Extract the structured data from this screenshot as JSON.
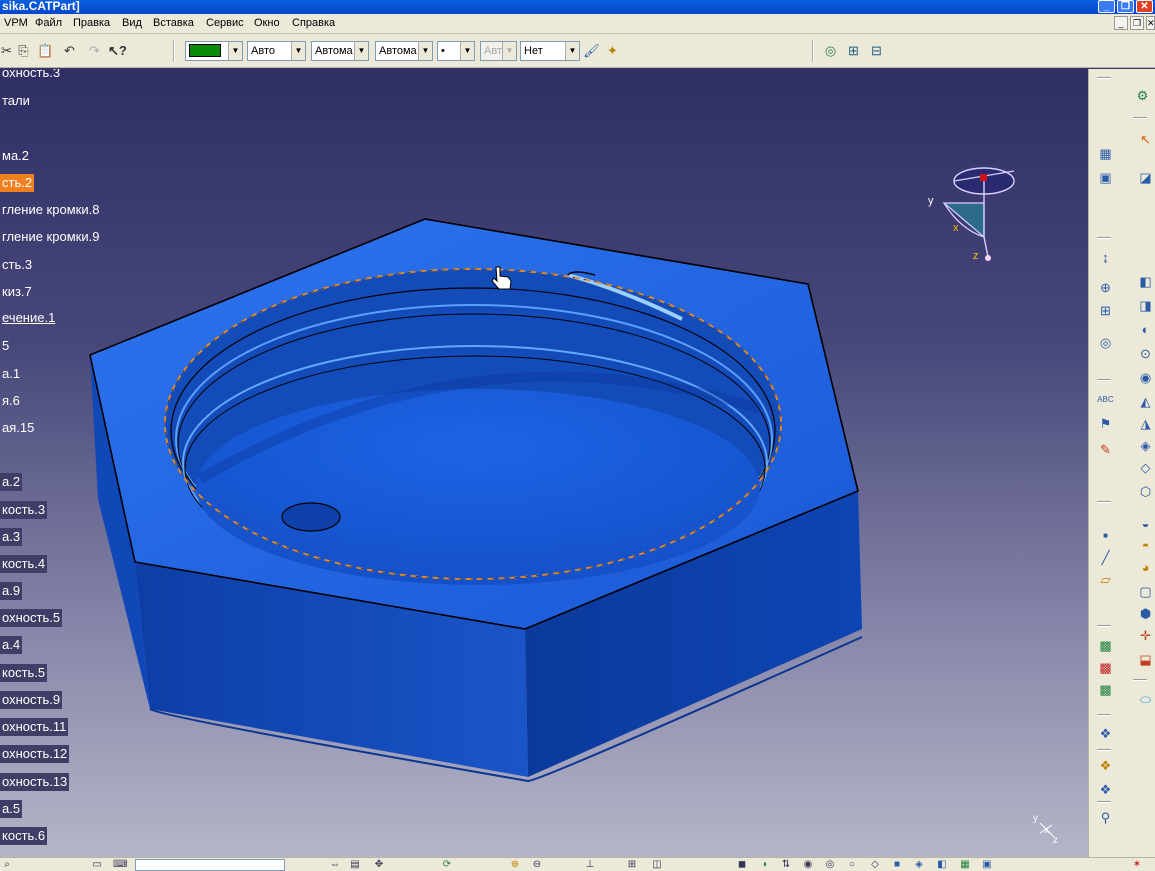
{
  "window": {
    "title": "sika.CATPart]"
  },
  "menu": [
    "VPM",
    "Файл",
    "Правка",
    "Вид",
    "Вставка",
    "Сервис",
    "Окно",
    "Справка"
  ],
  "toolbar": {
    "color_value": "#0a8a0a",
    "combo_transparency": "Авто",
    "combo_linetype": "Автома",
    "combo_thickness": "Автома",
    "combo_point": "•",
    "combo_layer_disabled": "Авт",
    "combo_layer": "Нет"
  },
  "tree": [
    {
      "label": "охность.3",
      "style": "plain"
    },
    {
      "label": "тали",
      "style": "plain"
    },
    {
      "label": "",
      "style": "plain"
    },
    {
      "label": "ма.2",
      "style": "plain"
    },
    {
      "label": "сть.2",
      "style": "sel"
    },
    {
      "label": "гление кромки.8",
      "style": "plain"
    },
    {
      "label": "гление кромки.9",
      "style": "plain"
    },
    {
      "label": "сть.3",
      "style": "plain"
    },
    {
      "label": "киз.7",
      "style": "plain"
    },
    {
      "label": "ечение.1",
      "style": "ul"
    },
    {
      "label": "5",
      "style": "plain"
    },
    {
      "label": "а.1",
      "style": "plain"
    },
    {
      "label": "я.6",
      "style": "plain"
    },
    {
      "label": "ая.15",
      "style": "plain"
    },
    {
      "label": "",
      "style": "plain"
    },
    {
      "label": "а.2",
      "style": "dark"
    },
    {
      "label": "кость.3",
      "style": "dark"
    },
    {
      "label": "а.3",
      "style": "dark"
    },
    {
      "label": "кость.4",
      "style": "dark"
    },
    {
      "label": "а.9",
      "style": "dark"
    },
    {
      "label": "охность.5",
      "style": "dark"
    },
    {
      "label": "а.4",
      "style": "dark"
    },
    {
      "label": "кость.5",
      "style": "dark"
    },
    {
      "label": "охность.9",
      "style": "dark"
    },
    {
      "label": "охность.11",
      "style": "dark"
    },
    {
      "label": "охность.12",
      "style": "dark"
    },
    {
      "label": "охность.13",
      "style": "dark"
    },
    {
      "label": "а.5",
      "style": "dark"
    },
    {
      "label": "кость.6",
      "style": "dark"
    }
  ],
  "compass": {
    "y_label": "y",
    "x_label": "x",
    "z_label": "z"
  },
  "axis_mini": {
    "y_label": "y",
    "x_label": "x",
    "z_label": "z"
  },
  "colors": {
    "part_blue": "#1e5ed8",
    "part_side": "#0f46b8",
    "highlight_dash": "#e88a20",
    "selection": "#f08020"
  }
}
